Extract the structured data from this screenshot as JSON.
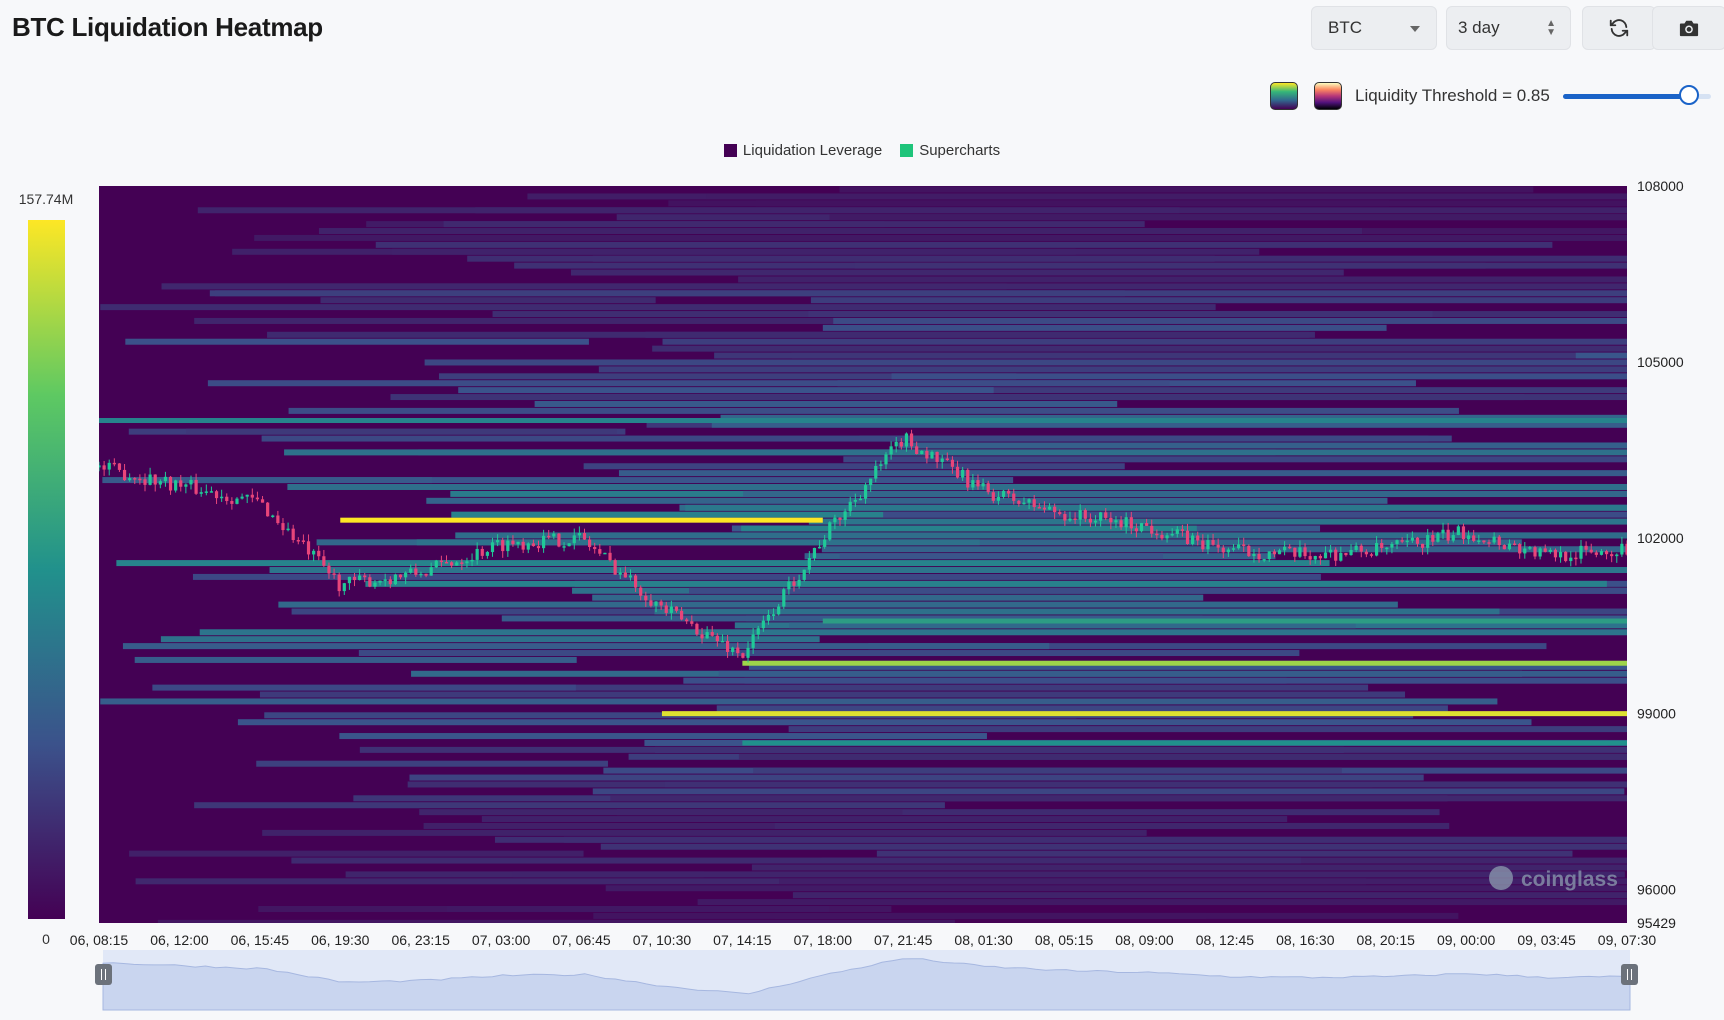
{
  "header": {
    "title": "BTC Liquidation Heatmap",
    "asset_select": "BTC",
    "range_select": "3 day",
    "threshold_label": "Liquidity Threshold = 0.85",
    "threshold_value": 0.85
  },
  "legend": {
    "items": [
      {
        "label": "Liquidation Leverage",
        "color": "#440154"
      },
      {
        "label": "Supercharts",
        "color": "#1ec47a"
      }
    ]
  },
  "colorbar": {
    "max_label": "157.74M",
    "min_label": "0"
  },
  "watermark": "coinglass",
  "colors": {
    "candle_up": "#20c997",
    "candle_down": "#e8457a",
    "heat_low": "#440154",
    "heat_high": "#fde725"
  },
  "chart_data": {
    "type": "heatmap",
    "title": "",
    "y_axis": {
      "min": 95429,
      "max": 108000,
      "ticks": [
        108000,
        105000,
        102000,
        99000,
        96000,
        95429
      ]
    },
    "x_axis": {
      "ticks": [
        "06, 08:15",
        "06, 12:00",
        "06, 15:45",
        "06, 19:30",
        "06, 23:15",
        "07, 03:00",
        "07, 06:45",
        "07, 10:30",
        "07, 14:15",
        "07, 18:00",
        "07, 21:45",
        "08, 01:30",
        "08, 05:15",
        "08, 09:00",
        "08, 12:45",
        "08, 16:30",
        "08, 20:15",
        "09, 00:00",
        "09, 03:45",
        "09, 07:30"
      ]
    },
    "color_scale": {
      "min": 0,
      "max": "157.74M",
      "palette": "viridis"
    },
    "bright_levels": [
      {
        "price": 102300,
        "from": "06, 19:30",
        "to": "07, 18:00",
        "intensity": 1.0
      },
      {
        "price": 99000,
        "from": "07, 10:30",
        "to": "09, 07:30",
        "intensity": 0.95
      },
      {
        "price": 99860,
        "from": "07, 14:15",
        "to": "09, 07:30",
        "intensity": 0.85
      },
      {
        "price": 104000,
        "from": "06, 08:15",
        "to": "09, 07:30",
        "intensity": 0.45
      },
      {
        "price": 100580,
        "from": "07, 18:00",
        "to": "09, 07:30",
        "intensity": 0.55
      },
      {
        "price": 98500,
        "from": "07, 14:15",
        "to": "09, 07:30",
        "intensity": 0.5
      }
    ],
    "price_series": [
      {
        "time": "06, 08:15",
        "price": 103200
      },
      {
        "time": "06, 12:00",
        "price": 102900
      },
      {
        "time": "06, 15:45",
        "price": 102600
      },
      {
        "time": "06, 19:30",
        "price": 101200
      },
      {
        "time": "06, 23:15",
        "price": 101400
      },
      {
        "time": "07, 03:00",
        "price": 101900
      },
      {
        "time": "07, 06:45",
        "price": 102000
      },
      {
        "time": "07, 10:30",
        "price": 100800
      },
      {
        "time": "07, 14:15",
        "price": 100000
      },
      {
        "time": "07, 18:00",
        "price": 102000
      },
      {
        "time": "07, 21:45",
        "price": 103700
      },
      {
        "time": "08, 01:30",
        "price": 102800
      },
      {
        "time": "08, 05:15",
        "price": 102400
      },
      {
        "time": "08, 09:00",
        "price": 102200
      },
      {
        "time": "08, 12:45",
        "price": 101800
      },
      {
        "time": "08, 16:30",
        "price": 101700
      },
      {
        "time": "08, 20:15",
        "price": 101800
      },
      {
        "time": "09, 00:00",
        "price": 102100
      },
      {
        "time": "09, 03:45",
        "price": 101700
      },
      {
        "time": "09, 07:30",
        "price": 101800
      }
    ]
  }
}
